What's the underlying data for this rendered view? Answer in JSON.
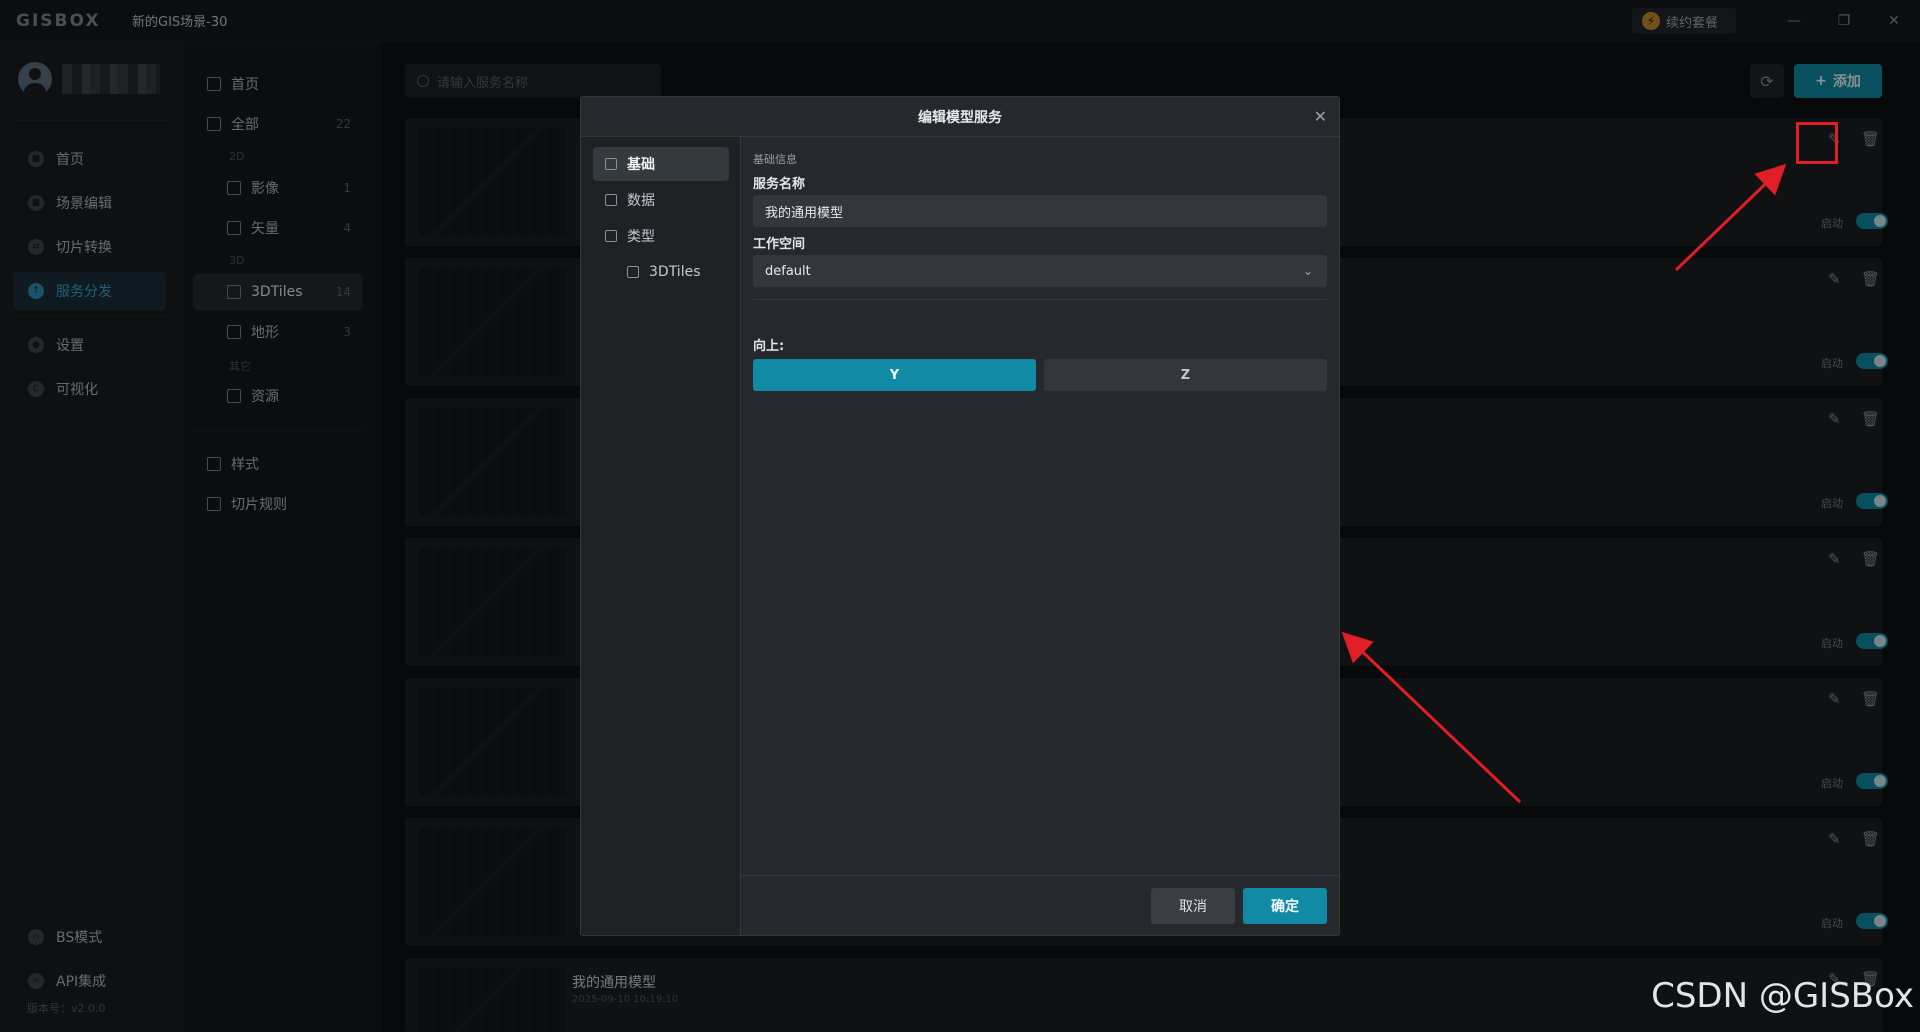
{
  "app": {
    "logo": "GISBOX",
    "title": "新的GIS场景-30",
    "renew_label": "续约套餐",
    "win_min": "—",
    "win_restore": "❐",
    "win_close": "✕"
  },
  "leftnav": {
    "items": [
      {
        "label": "首页"
      },
      {
        "label": "场景编辑"
      },
      {
        "label": "切片转换"
      },
      {
        "label": "服务分发"
      },
      {
        "label": "设置"
      },
      {
        "label": "可视化"
      }
    ],
    "bottom": [
      {
        "label": "BS模式"
      },
      {
        "label": "API集成"
      }
    ],
    "version": "版本号：v2.0.0"
  },
  "subnav": {
    "home": "首页",
    "all": {
      "label": "全部",
      "count": "22"
    },
    "group_2d": "2D",
    "imagery": {
      "label": "影像",
      "count": "1"
    },
    "vector": {
      "label": "矢量",
      "count": "4"
    },
    "group_3d": "3D",
    "tiles3d": {
      "label": "3DTiles",
      "count": "14"
    },
    "terrain": {
      "label": "地形",
      "count": "3"
    },
    "group_other": "其它",
    "resource": {
      "label": "资源"
    },
    "style": "样式",
    "tile_rules": "切片规则"
  },
  "main": {
    "search_placeholder": "请输入服务名称",
    "refresh_icon": "⟳",
    "add_label": "添加",
    "toggle_label": "启动",
    "last_card": {
      "name": "我的通用模型",
      "date": "2025-09-10 10:19:10"
    }
  },
  "modal": {
    "title": "编辑模型服务",
    "close": "✕",
    "side": [
      {
        "label": "基础"
      },
      {
        "label": "数据"
      },
      {
        "label": "类型"
      },
      {
        "label": "3DTiles"
      }
    ],
    "section_title": "基础信息",
    "service_name_label": "服务名称",
    "service_name_value": "我的通用模型",
    "workspace_label": "工作空间",
    "workspace_value": "default",
    "workspace_chevron": "⌄",
    "up_label": "向上:",
    "up_options": [
      "Y",
      "Z"
    ],
    "up_selected": "Y",
    "cancel": "取消",
    "ok": "确定"
  },
  "annotation": {
    "accent": "#e01e25"
  },
  "watermark": "CSDN @GISBox"
}
